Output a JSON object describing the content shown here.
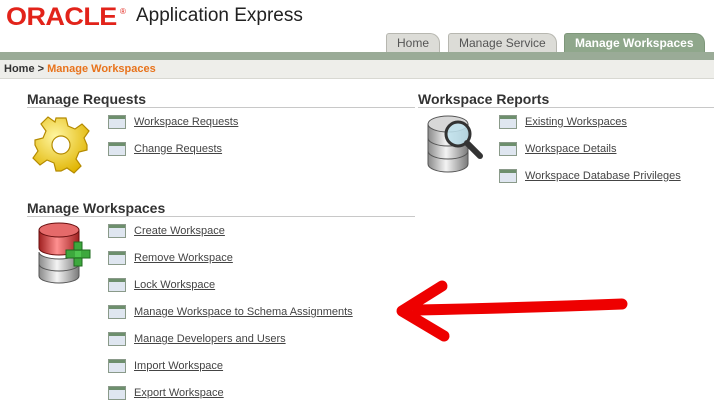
{
  "header": {
    "logo_text": "ORACLE",
    "trademark": "®",
    "app_title": "Application Express"
  },
  "tabs": [
    {
      "label": "Home",
      "active": false
    },
    {
      "label": "Manage Service",
      "active": false
    },
    {
      "label": "Manage Workspaces",
      "active": true
    }
  ],
  "breadcrumb": {
    "home": "Home",
    "separator": ">",
    "current": "Manage Workspaces"
  },
  "sections": {
    "manage_requests": {
      "title": "Manage Requests",
      "icon": "gear-icon",
      "links": [
        "Workspace Requests",
        "Change Requests"
      ]
    },
    "workspace_reports": {
      "title": "Workspace Reports",
      "icon": "database-search-icon",
      "links": [
        "Existing Workspaces",
        "Workspace Details",
        "Workspace Database Privileges"
      ]
    },
    "manage_workspaces": {
      "title": "Manage Workspaces",
      "icon": "database-add-icon",
      "links": [
        "Create Workspace",
        "Remove Workspace",
        "Lock Workspace",
        "Manage Workspace to Schema Assignments",
        "Manage Developers and Users",
        "Import Workspace",
        "Export Workspace"
      ]
    }
  },
  "colors": {
    "brand_red": "#e2231a",
    "active_tab": "#8fa78b",
    "breadcrumb_current": "#e8731c",
    "annotation_arrow": "#ee0000"
  }
}
